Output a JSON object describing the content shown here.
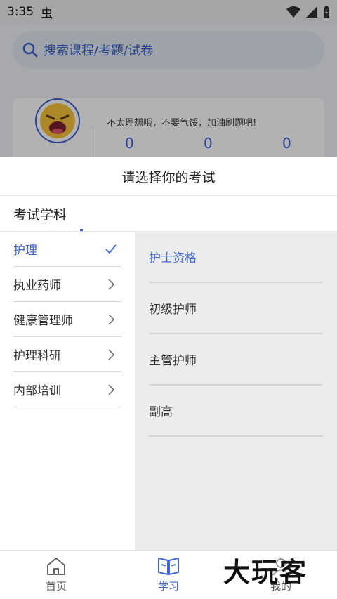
{
  "status": {
    "time": "3:35",
    "bug_glyph": "虫"
  },
  "search": {
    "placeholder": "搜索课程/考题/试卷"
  },
  "profile": {
    "motto": "不太理想哦，不要气馁，加油刷题吧!",
    "stats": [
      "0",
      "0",
      "0"
    ]
  },
  "sheet": {
    "title": "请选择你的考试",
    "subject_header": "考试学科",
    "left_items": [
      {
        "label": "护理",
        "active": true
      },
      {
        "label": "执业药师",
        "active": false
      },
      {
        "label": "健康管理师",
        "active": false
      },
      {
        "label": "护理科研",
        "active": false
      },
      {
        "label": "内部培训",
        "active": false
      }
    ],
    "right_items": [
      {
        "label": "护士资格",
        "active": true
      },
      {
        "label": "初级护师",
        "active": false
      },
      {
        "label": "主管护师",
        "active": false
      },
      {
        "label": "副高",
        "active": false
      }
    ]
  },
  "tabs": [
    {
      "label": "首页",
      "icon": "home-icon"
    },
    {
      "label": "学习",
      "icon": "book-icon",
      "active": true
    },
    {
      "label": "我的",
      "icon": "profile-icon"
    }
  ],
  "watermark": "大玩客",
  "colors": {
    "accent": "#3f67cf",
    "sheet_bg": "#ffffff",
    "right_panel_bg": "#ececec"
  }
}
